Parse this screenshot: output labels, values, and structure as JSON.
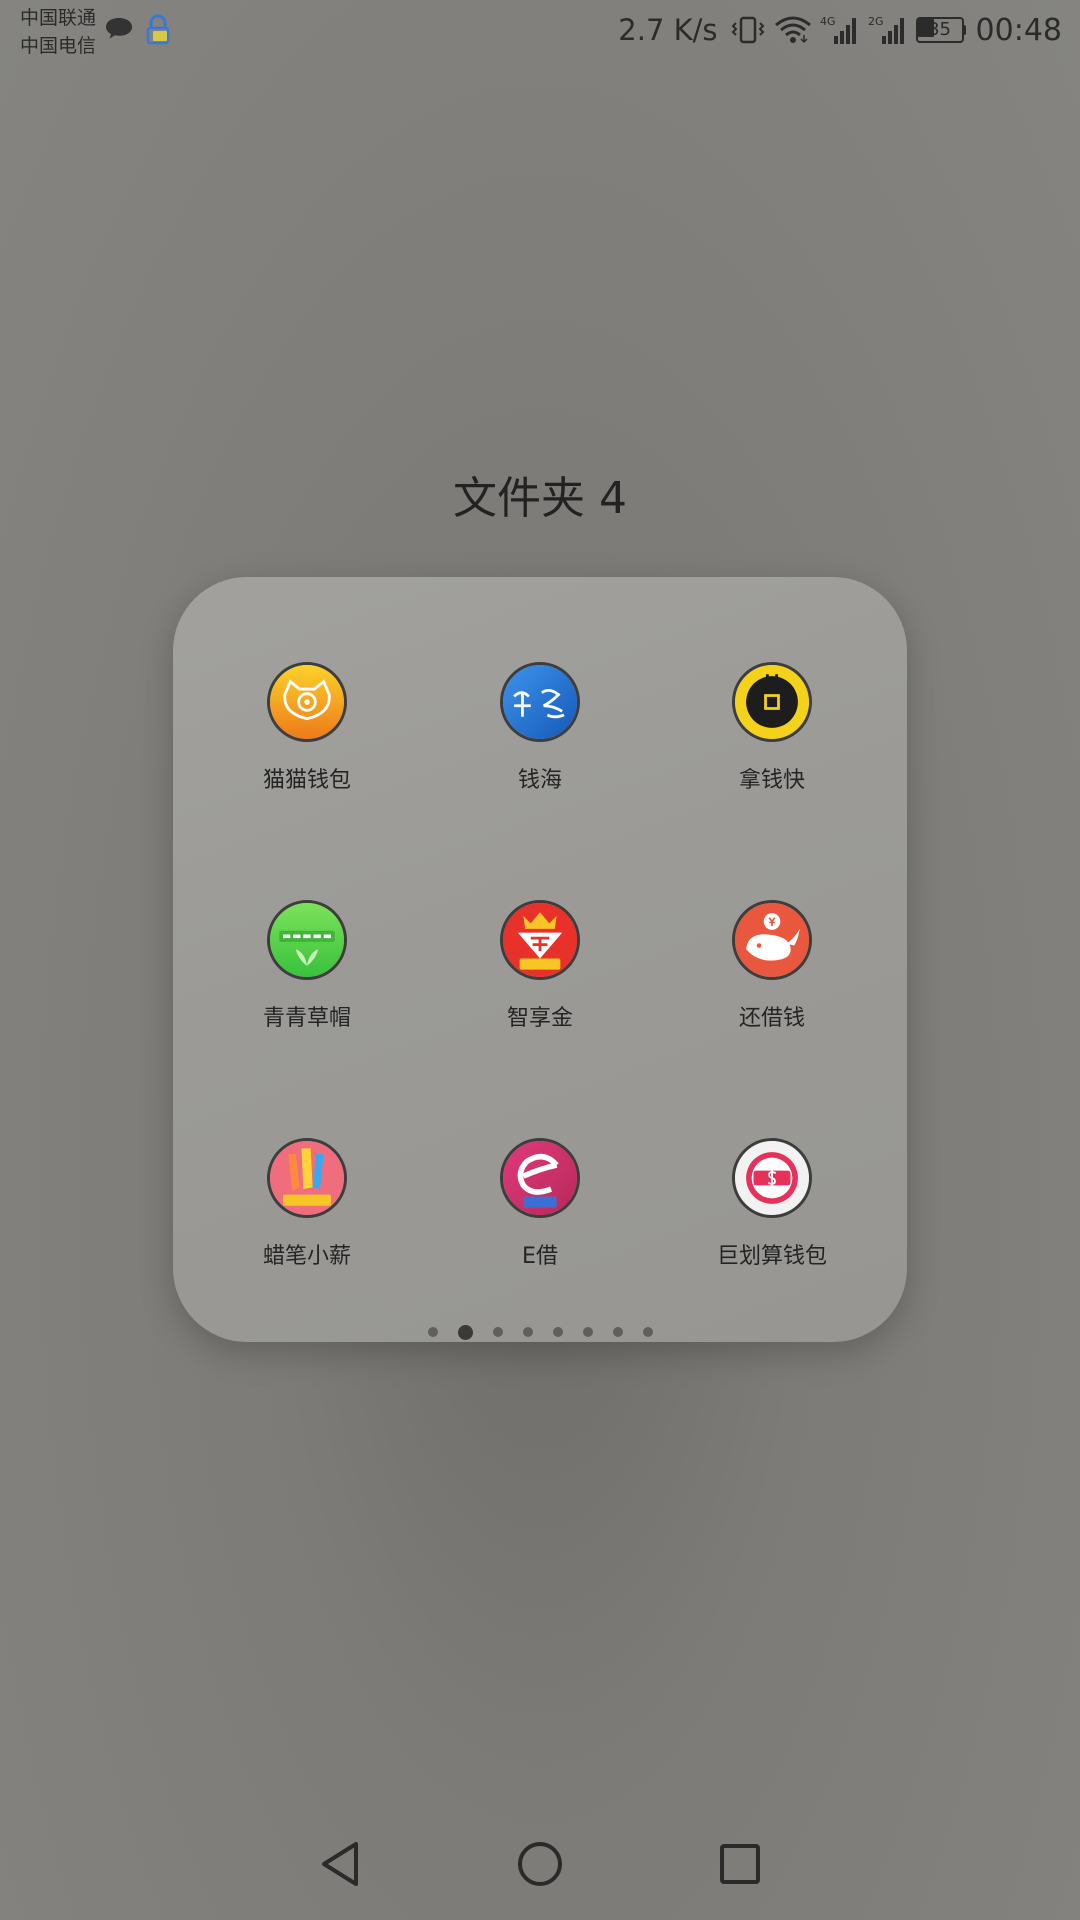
{
  "status_bar": {
    "carrier_1": "中国联通",
    "carrier_2": "中国电信",
    "net_speed": "2.7 K/s",
    "network_1": "4G",
    "network_2": "2G",
    "battery_level": "35",
    "time": "00:48"
  },
  "folder": {
    "title": "文件夹 4",
    "apps": [
      {
        "label": "猫猫钱包",
        "icon": "cat-wallet-icon",
        "color": "#f29a1f"
      },
      {
        "label": "钱海",
        "icon": "qianhai-icon",
        "color": "#1f6fd1"
      },
      {
        "label": "拿钱快",
        "icon": "naqiankuai-icon",
        "color": "#f4d21c"
      },
      {
        "label": "青青草帽",
        "icon": "green-strawhat-icon",
        "color": "#4cd43e"
      },
      {
        "label": "智享金",
        "icon": "zhixiangjin-icon",
        "color": "#e8312a"
      },
      {
        "label": "还借钱",
        "icon": "whale-icon",
        "color": "#e9573e"
      },
      {
        "label": "蜡笔小薪",
        "icon": "crayon-icon",
        "color": "#f06d7e"
      },
      {
        "label": "E借",
        "icon": "e-loan-icon",
        "color": "#d12e6a"
      },
      {
        "label": "巨划算钱包",
        "icon": "jusuan-wallet-icon",
        "color": "#e6315a"
      }
    ],
    "page_count": 8,
    "current_page": 2
  }
}
